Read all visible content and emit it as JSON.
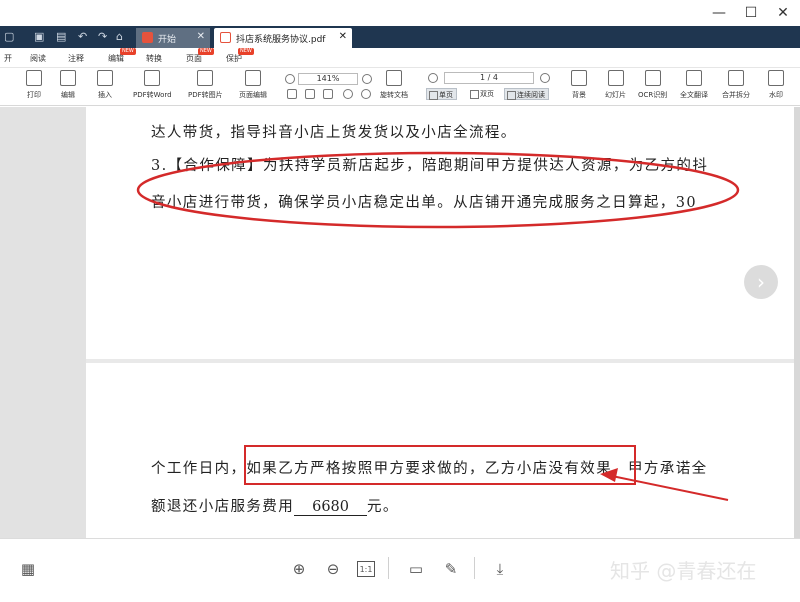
{
  "window": {
    "minimize_icon": "—",
    "maximize_icon": "☐",
    "close_icon": "✕"
  },
  "tabs": [
    {
      "label": "开始"
    },
    {
      "label": "抖店系统服务协议.pdf"
    }
  ],
  "menu": {
    "items": [
      "开",
      "阅读",
      "注释",
      "编辑",
      "转换",
      "页面",
      "保护"
    ],
    "new_badge": "NEW"
  },
  "toolbar": {
    "tools_left": [
      "打印",
      "编辑",
      "插入",
      "PDF转Word",
      "PDF转图片",
      "页面编辑"
    ],
    "zoom_value": "141%",
    "rotate_label": "旋转文档",
    "page_indicator": "1 / 4",
    "view_modes": [
      "单页",
      "双页",
      "连续阅读"
    ],
    "tools_right": [
      "背景",
      "幻灯片",
      "OCR识别",
      "全文翻译",
      "合并拆分",
      "水印"
    ]
  },
  "document": {
    "page1_lines": [
      "达人带货，指导抖音小店上货发货以及小店全流程。",
      "3.【合作保障】为扶持学员新店起步，陪跑期间甲方提供达人资源，为乙方的抖",
      "音小店进行带货，确保学员小店稳定出单。从店铺开通完成服务之日算起，30"
    ],
    "page2_line1": "个工作日内，如果乙方严格按照甲方要求做的，乙方小店没有效果，甲方承诺全",
    "page2_line2_prefix": "额退还小店服务费用",
    "refund_amount": "6680",
    "page2_line2_suffix": "元。"
  },
  "bottom": {
    "watermark": "知乎 @青春还在",
    "fit_label": "1:1"
  },
  "colors": {
    "tab_bar": "#1f3650",
    "annotation_red": "#d42a2a"
  }
}
